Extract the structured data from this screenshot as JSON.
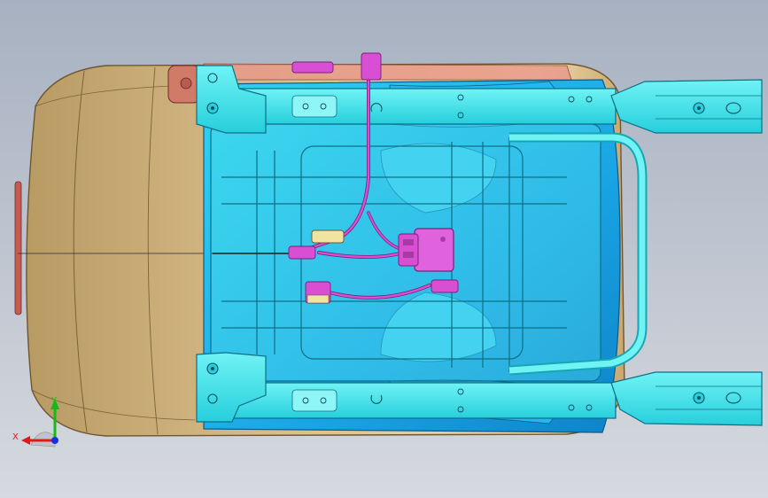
{
  "view": {
    "background_top": "#a7b1c1",
    "background_bottom": "#d6d9df"
  },
  "colors": {
    "cushion": "#d4b581",
    "cushion_dark": "#9a7a48",
    "frame": "#3fe8ec",
    "frame_dark": "#15a7b4",
    "pan": "#1aa6e6",
    "pan_dark": "#0a6fb0",
    "harness": "#d84fd4",
    "harness_dark": "#7a1f78",
    "connector_yellow": "#f1e4a0"
  },
  "triad": {
    "x_label": "X",
    "y_label": "Y",
    "x_color": "#e01818",
    "y_color": "#18b818",
    "z_color": "#1830e0"
  }
}
